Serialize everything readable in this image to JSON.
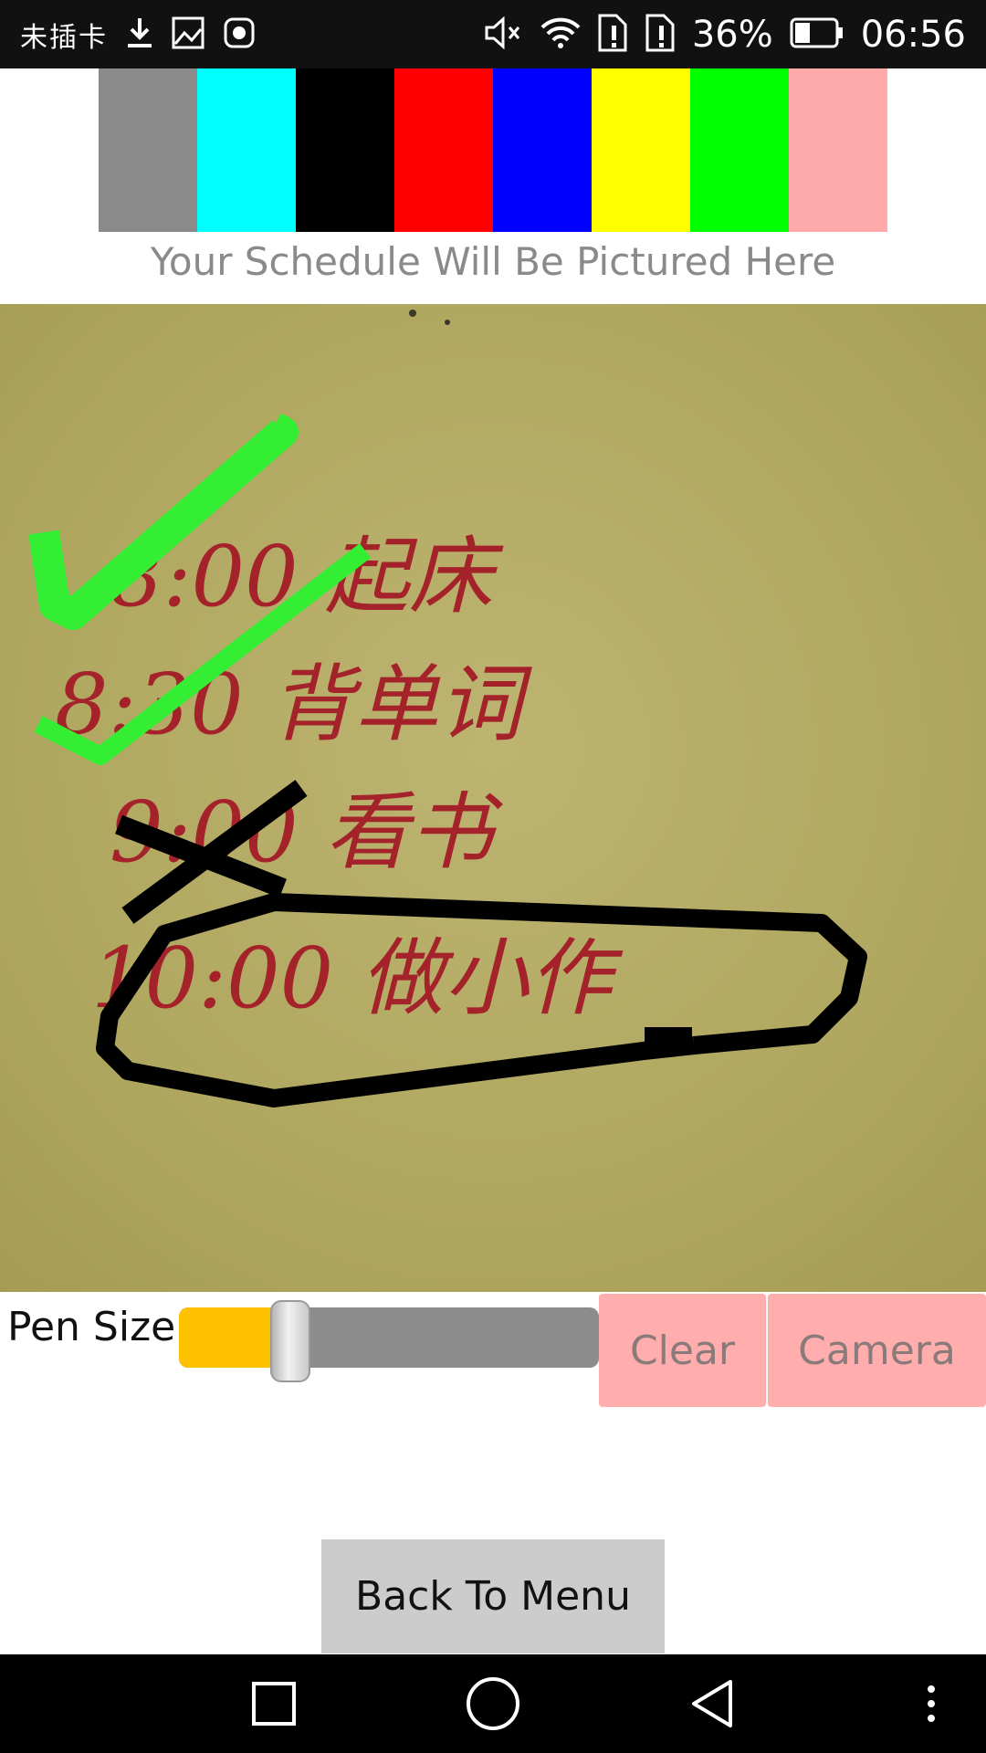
{
  "status_bar": {
    "carrier": "未插卡",
    "battery_percent": "36%",
    "time": "06:56",
    "icons": [
      "download-icon",
      "image-icon",
      "huawei-icon",
      "mute-icon",
      "wifi-icon",
      "sim1-alert-icon",
      "sim2-alert-icon",
      "battery-icon"
    ]
  },
  "palette": {
    "colors": [
      "#8a8a8a",
      "#00ffff",
      "#000000",
      "#ff0000",
      "#0000ff",
      "#ffff00",
      "#00ff00",
      "#ffaaaa"
    ]
  },
  "caption": "Your Schedule Will Be Pictured Here",
  "canvas": {
    "handwritten_text": [
      "8:00 起床",
      "8:30 背单词",
      "9:00 看书",
      "10:00 做小作"
    ],
    "photo_color": "#b5ab63"
  },
  "controls": {
    "pen_size_label": "Pen Size",
    "pen_size_value": 0.24,
    "clear_label": "Clear",
    "camera_label": "Camera"
  },
  "back_button": "Back To Menu",
  "nav_bar": {
    "icons": [
      "recents-icon",
      "home-icon",
      "back-icon",
      "more-icon"
    ]
  }
}
